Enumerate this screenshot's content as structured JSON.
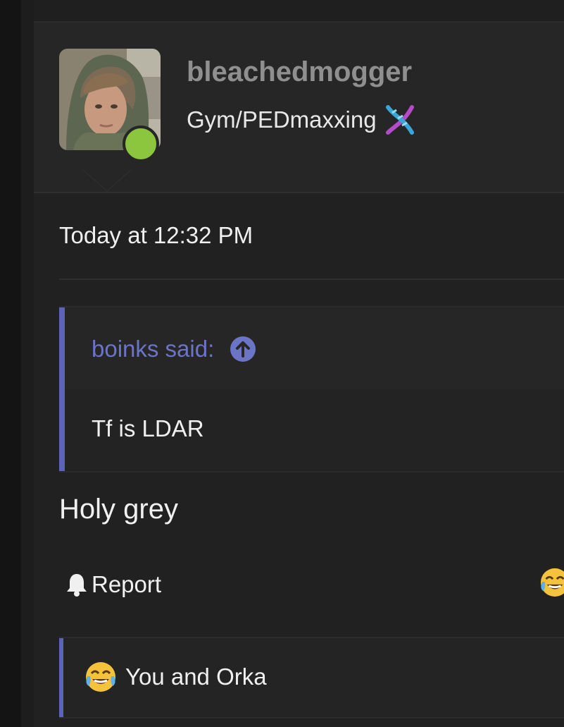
{
  "user": {
    "username": "bleachedmogger",
    "title": "Gym/PEDmaxxing",
    "title_icon": "dna-icon",
    "online_status_color": "#8cc63f",
    "avatar": "user-avatar-photo"
  },
  "post": {
    "timestamp": "Today at 12:32 PM",
    "quote": {
      "author_line": "boinks said:",
      "jump_icon": "arrow-up-circle-icon",
      "text": "Tf is LDAR"
    },
    "text": "Holy grey",
    "actions": {
      "report_label": "Report",
      "report_icon": "bell-icon",
      "react_icon": "face-with-tears-of-joy-icon"
    },
    "reactions": {
      "icon": "face-with-tears-of-joy-icon",
      "summary": "You and Orka"
    }
  },
  "colors": {
    "background": "#212121",
    "accent": "#5c63b8",
    "quote_author": "#6c74c6",
    "username": "#8f8f8f",
    "text": "#f0f0f0"
  }
}
